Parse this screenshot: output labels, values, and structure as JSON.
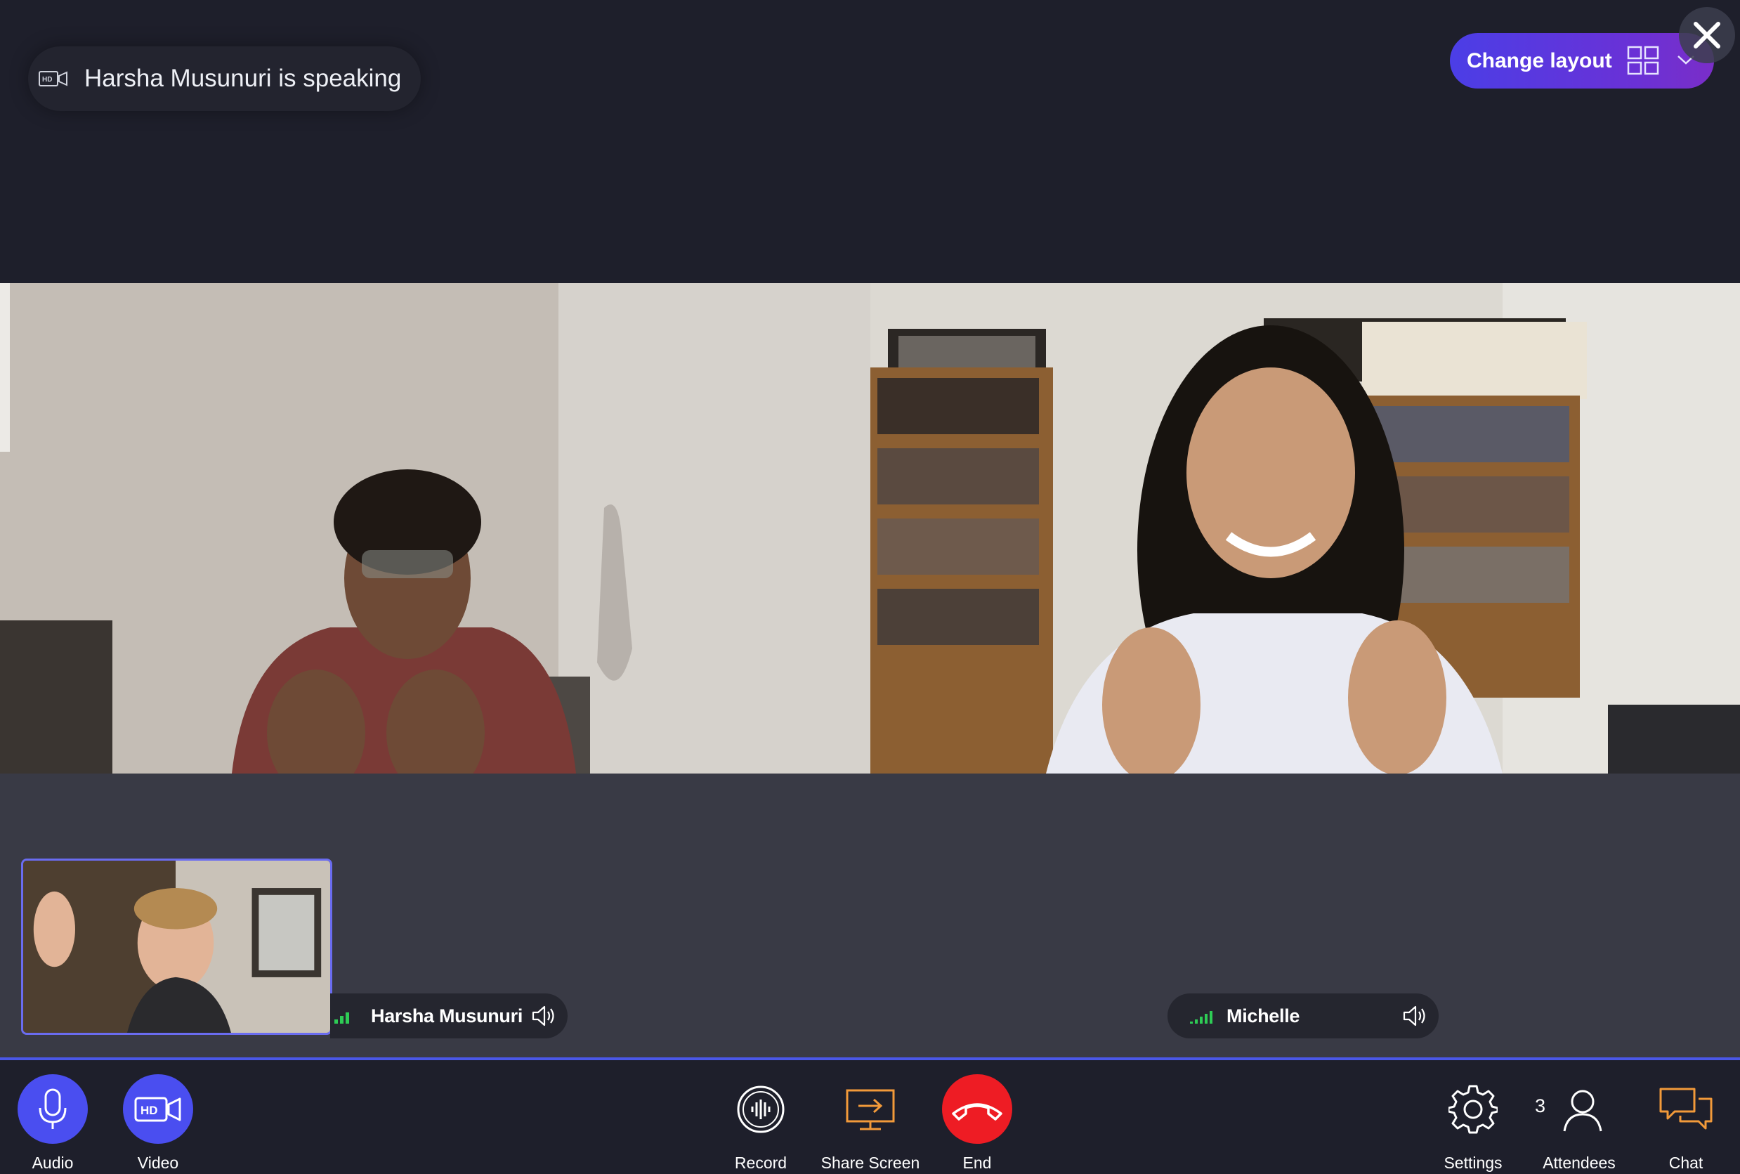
{
  "header": {
    "speaking_text": "Harsha Musunuri is speaking",
    "change_layout_label": "Change layout"
  },
  "participants": [
    {
      "name": "Harsha Musunuri"
    },
    {
      "name": "Michelle"
    }
  ],
  "toolbar": {
    "audio_label": "Audio",
    "video_label": "Video",
    "video_icon_text": "HD",
    "record_label": "Record",
    "share_label": "Share Screen",
    "end_label": "End",
    "settings_label": "Settings",
    "attendees_label": "Attendees",
    "attendees_count": "3",
    "chat_label": "Chat"
  },
  "colors": {
    "background": "#1e1f2b",
    "video_area": "#393a45",
    "accent_blue": "#4a4ef0",
    "end_red": "#ee1c24",
    "layout_gradient_start": "#4b3ee6",
    "layout_gradient_end": "#7a2ec8",
    "signal_green": "#2ecc55",
    "share_orange": "#f29a3a"
  },
  "icons": {
    "hd": "hd-camera-icon",
    "layout": "grid-layout-icon",
    "chevron": "chevron-down-icon",
    "close": "close-icon",
    "signal": "signal-bars-icon",
    "speaker": "speaker-icon",
    "microphone": "microphone-icon",
    "video": "hd-video-icon",
    "record": "record-icon",
    "share": "share-screen-icon",
    "end": "hang-up-icon",
    "settings": "gear-icon",
    "attendees": "person-icon",
    "chat": "chat-bubbles-icon"
  }
}
